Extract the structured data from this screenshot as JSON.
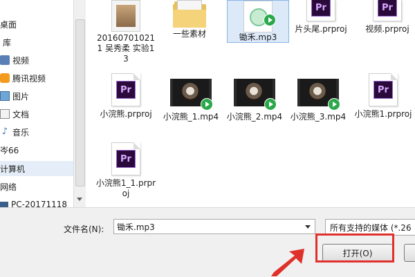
{
  "nav": {
    "items": [
      {
        "label": "桌面",
        "icon": "desktop-icon"
      },
      {
        "label": "库",
        "icon": "library-icon"
      },
      {
        "label": "视频",
        "icon": "video-folder-icon"
      },
      {
        "label": "腾讯视频",
        "icon": "tencent-video-icon"
      },
      {
        "label": "图片",
        "icon": "pictures-icon"
      },
      {
        "label": "文档",
        "icon": "documents-icon"
      },
      {
        "label": "音乐",
        "icon": "music-icon"
      },
      {
        "label": "岑66",
        "icon": "user-icon"
      },
      {
        "label": "计算机",
        "icon": "computer-icon"
      },
      {
        "label": "网络",
        "icon": "network-icon"
      },
      {
        "label": "PC-20171118",
        "icon": "pc-icon"
      }
    ]
  },
  "files": [
    {
      "name": "201607010211 吴秀柔 实验13",
      "type": "project-thumb"
    },
    {
      "name": "一些素材",
      "type": "folder"
    },
    {
      "name": "锄禾.mp3",
      "type": "mp3",
      "selected": true
    },
    {
      "name": "片头尾.prproj",
      "type": "prproj"
    },
    {
      "name": "视频.prproj",
      "type": "prproj"
    },
    {
      "name": "小浣熊.prproj",
      "type": "prproj"
    },
    {
      "name": "小浣熊_1.mp4",
      "type": "mp4"
    },
    {
      "name": "小浣熊_2.mp4",
      "type": "mp4"
    },
    {
      "name": "小浣熊_3.mp4",
      "type": "mp4"
    },
    {
      "name": "小浣熊1.prproj",
      "type": "prproj"
    },
    {
      "name": "小浣熊1_1.prproj",
      "type": "prproj"
    }
  ],
  "bottom": {
    "filename_label": "文件名(N):",
    "filename_value": "锄禾.mp3",
    "filetype_value": "所有支持的媒体 (*.26",
    "open_label": "打开(O)"
  },
  "colors": {
    "highlight": "#e0302a",
    "selection": "#dce9f9"
  }
}
